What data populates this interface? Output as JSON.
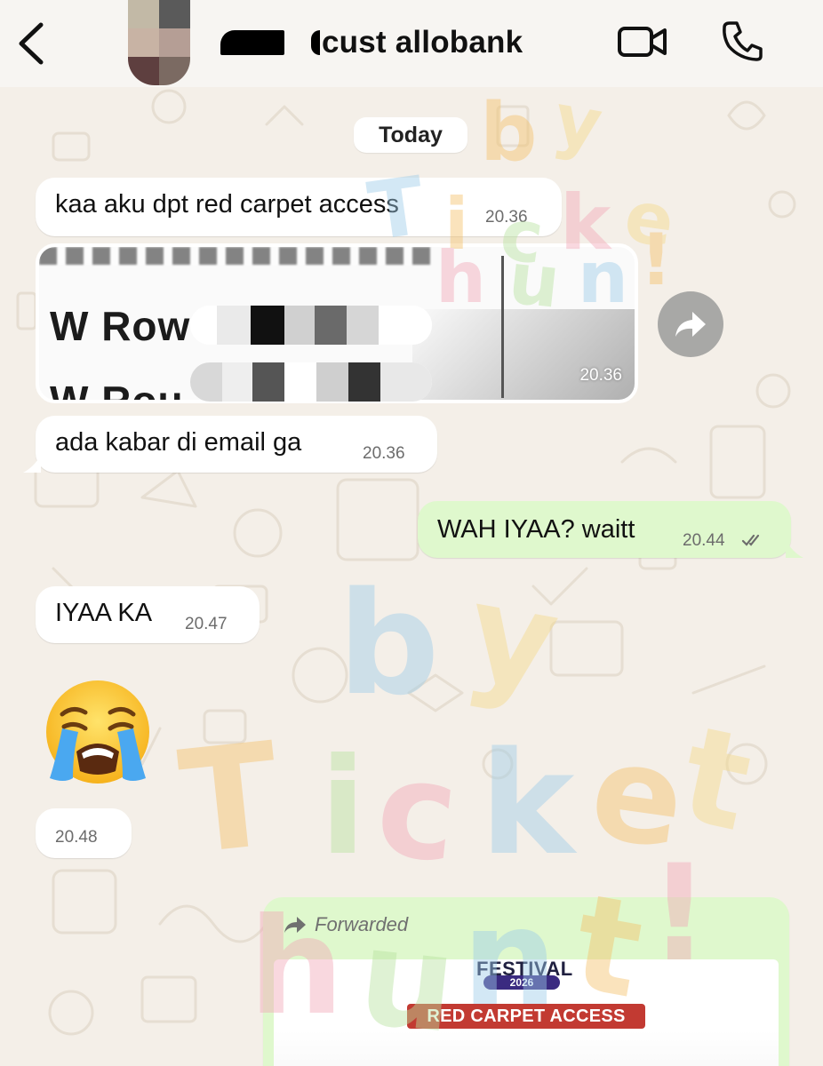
{
  "header": {
    "contact_name": "cust allobank",
    "back_icon": "chevron-left-icon",
    "video_icon": "video-camera-icon",
    "call_icon": "phone-icon",
    "avatar_colors": [
      "#c2b9a6",
      "#5a5a5a",
      "#c8b3a4",
      "#b59e95",
      "#5e3f3f",
      "#7b6a62"
    ]
  },
  "chat": {
    "date_label": "Today",
    "messages": [
      {
        "direction": "in",
        "text": "kaa aku dpt red carpet access",
        "time": "20.36"
      },
      {
        "direction": "in",
        "type": "image",
        "image_text_1": "W Row",
        "image_text_2": "W Rou",
        "time": "20.36"
      },
      {
        "direction": "in",
        "text": "ada kabar di email ga",
        "time": "20.36"
      },
      {
        "direction": "out",
        "text": "WAH IYAA? waitt",
        "time": "20.44",
        "status": "read"
      },
      {
        "direction": "in",
        "text": "IYAA KA",
        "time": "20.47"
      },
      {
        "direction": "in",
        "type": "emoji",
        "emoji": "loudly-crying-face",
        "time": "20.48"
      },
      {
        "direction": "out",
        "type": "forwarded",
        "forwarded_label": "Forwarded",
        "card_title": "FESTIVAL",
        "card_year": "2026",
        "card_badge": "RED CARPET ACCESS"
      }
    ]
  },
  "watermark": {
    "text": "by Ticket hunt!",
    "colors": [
      "#f4c06a",
      "#9ccbe8",
      "#f2a7b8",
      "#b7e3a0",
      "#f3d98a"
    ]
  },
  "colors": {
    "background": "#f4efe8",
    "incoming_bubble": "#ffffff",
    "outgoing_bubble": "#dff8cd",
    "read_ticks": "#6c6c6c"
  }
}
